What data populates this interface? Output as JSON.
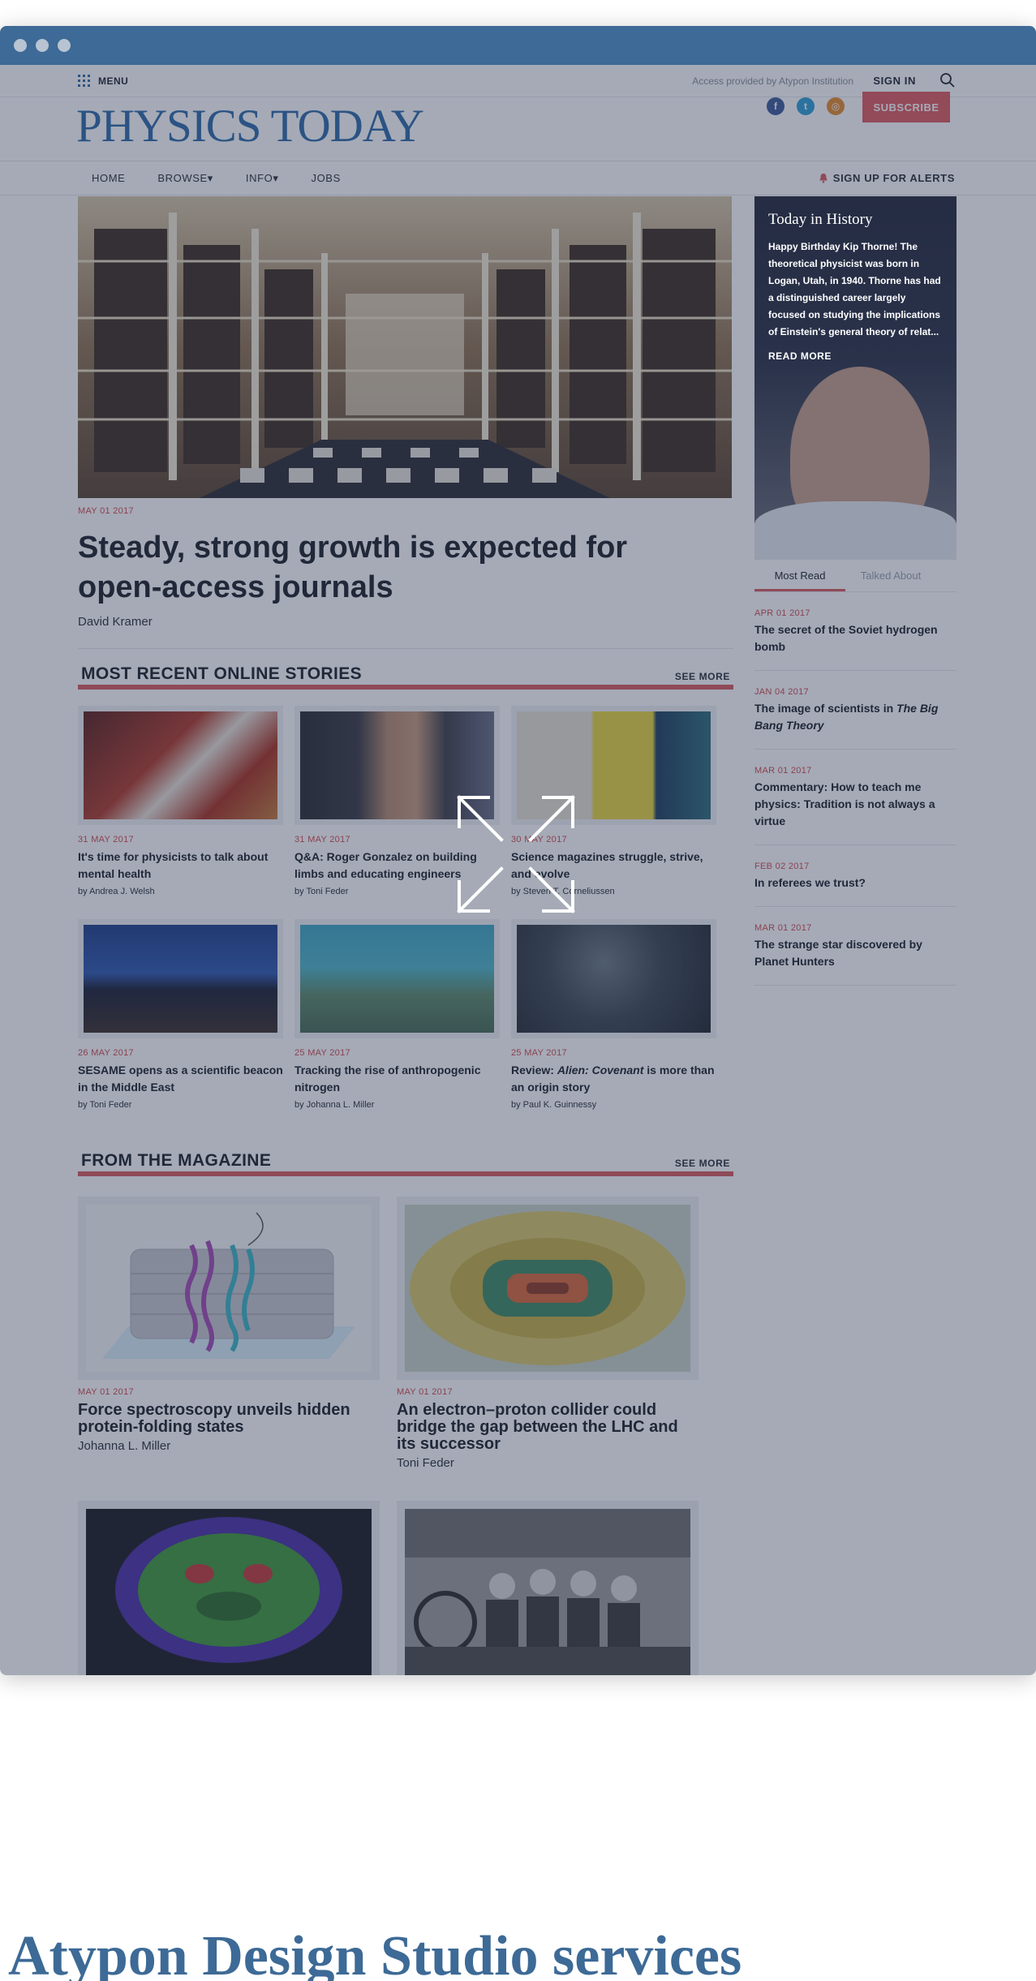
{
  "header": {
    "menu_label": "MENU",
    "access_text": "Access provided by Atypon Institution",
    "signin_label": "SIGN IN",
    "logo_text": "PHYSICS TODAY",
    "subscribe_label": "SUBSCRIBE",
    "social_icons": [
      "facebook-icon",
      "twitter-icon",
      "rss-icon"
    ]
  },
  "nav": {
    "items": [
      "HOME",
      "BROWSE▾",
      "INFO▾",
      "JOBS"
    ],
    "alerts_label": "SIGN UP FOR ALERTS"
  },
  "feature": {
    "date": "MAY 01 2017",
    "title": "Steady, strong growth is expected for open-access journals",
    "author": "David Kramer"
  },
  "recent": {
    "heading": "MOST RECENT ONLINE STORIES",
    "see_more": "SEE MORE",
    "cards": [
      {
        "date": "31 MAY 2017",
        "title": "It's time for physicists to talk about mental health",
        "author": "by Andrea J. Welsh"
      },
      {
        "date": "31 MAY 2017",
        "title": "Q&A: Roger Gonzalez on building limbs and educating engineers",
        "author": "by Toni Feder"
      },
      {
        "date": "30 MAY 2017",
        "title": "Science magazines struggle, strive, and evolve",
        "author": "by Steven T. Corneliussen"
      },
      {
        "date": "26 MAY 2017",
        "title": "SESAME opens as a scientific beacon in the Middle East",
        "author": "by Toni Feder"
      },
      {
        "date": "25 MAY 2017",
        "title": "Tracking the rise of anthropogenic nitrogen",
        "author": "by Johanna L. Miller"
      },
      {
        "date": "25 MAY 2017",
        "title_pre": "Review: ",
        "title_em": "Alien: Covenant",
        "title_post": " is more than an origin story",
        "author": "by Paul K. Guinnessy"
      }
    ]
  },
  "magazine": {
    "heading": "FROM THE MAGAZINE",
    "see_more": "SEE MORE",
    "cards": [
      {
        "date": "MAY 01 2017",
        "title": "Force spectroscopy unveils hidden protein-folding states",
        "author": "Johanna L. Miller"
      },
      {
        "date": "MAY 01 2017",
        "title": "An electron–proton collider could bridge the gap between the LHC and its successor",
        "author": "Toni Feder"
      }
    ]
  },
  "sidebar": {
    "history_title": "Today in History",
    "history_text": "Happy Birthday Kip Thorne! The theoretical physicist was born in Logan, Utah, in 1940. Thorne has had a distinguished career largely focused on studying the implications of Einstein's general theory of relat...",
    "read_more": "READ MORE",
    "tabs": [
      "Most Read",
      "Talked About"
    ],
    "most_read": [
      {
        "date": "APR 01 2017",
        "title": "The secret of the Soviet hydrogen bomb"
      },
      {
        "date": "JAN 04 2017",
        "title_pre": "The image of scientists in ",
        "title_em": "The Big Bang Theory"
      },
      {
        "date": "MAR 01 2017",
        "title": "Commentary: How to teach me physics: Tradition is not always a virtue"
      },
      {
        "date": "FEB 02 2017",
        "title": "In referees we trust?"
      },
      {
        "date": "MAR 01 2017",
        "title": "The strange star discovered by Planet Hunters"
      }
    ]
  },
  "footer": {
    "title": "Atypon Design Studio services"
  },
  "colors": {
    "brand_blue": "#2e6aa9",
    "accent_red": "#d95a5e",
    "chrome": "#3d6a96"
  }
}
